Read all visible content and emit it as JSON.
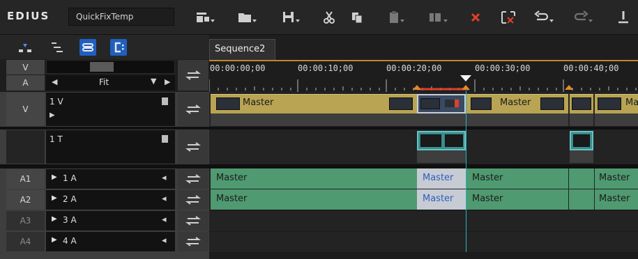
{
  "app": {
    "brand": "EDIUS",
    "project_name": "QuickFixTemp"
  },
  "toolbar": {
    "buttons": [
      {
        "name": "new-sequence-icon",
        "dropdown": true
      },
      {
        "name": "open-folder-icon",
        "dropdown": true
      },
      {
        "name": "save-icon",
        "dropdown": true
      },
      {
        "name": "cut-icon",
        "dropdown": false
      },
      {
        "name": "copy-icon",
        "dropdown": false
      },
      {
        "name": "paste-icon",
        "dropdown": true
      },
      {
        "name": "insert-clip-icon",
        "dropdown": true
      },
      {
        "name": "delete-icon",
        "dropdown": false
      },
      {
        "name": "ripple-delete-icon",
        "dropdown": false
      },
      {
        "name": "undo-icon",
        "dropdown": true
      },
      {
        "name": "redo-icon",
        "dropdown": true
      },
      {
        "name": "set-marker-icon",
        "dropdown": false
      }
    ]
  },
  "tabs": [
    {
      "label": "Sequence2",
      "active": true
    }
  ],
  "header": {
    "v_label": "V",
    "a_label": "A",
    "zoom_label": "Fit"
  },
  "ruler": {
    "timecodes": [
      "00:00:00;00",
      "00:00:10;00",
      "00:00:20;00",
      "00:00:30;00",
      "00:00:40;00"
    ]
  },
  "tracks": [
    {
      "id": "V",
      "name": "1 V",
      "type": "video"
    },
    {
      "id": "",
      "name": "1 T",
      "type": "title"
    },
    {
      "id": "A1",
      "name": "1 A",
      "type": "audio"
    },
    {
      "id": "A2",
      "name": "2 A",
      "type": "audio"
    },
    {
      "id": "A3",
      "name": "3 A",
      "type": "audio"
    },
    {
      "id": "A4",
      "name": "4 A",
      "type": "audio"
    }
  ],
  "clips": {
    "video": [
      "Master",
      "Master",
      "Ma"
    ],
    "audio1": [
      "Master",
      "Master",
      "Master",
      "Master"
    ],
    "audio2": [
      "Master",
      "Master",
      "Master",
      "Master"
    ]
  },
  "colors": {
    "video_clip": "#b8a453",
    "audio_clip": "#4f9a71",
    "selected_audio": "#c7cbd3",
    "selected_text": "#2f5fbf",
    "active_mode": "#1f5fbf",
    "playhead": "#25b5c0",
    "ruler_accent": "#c0862e"
  }
}
